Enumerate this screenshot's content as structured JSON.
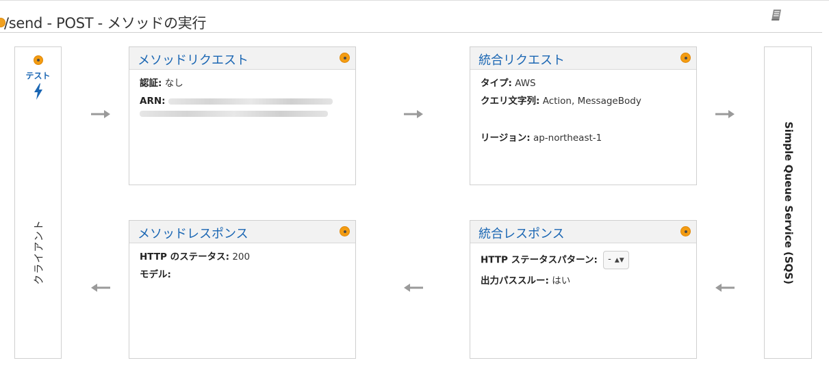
{
  "header": {
    "title": "/send - POST - メソッドの実行"
  },
  "client": {
    "test_label": "テスト",
    "label": "クライアント"
  },
  "backend": {
    "label": "Simple Queue Service (SQS)"
  },
  "method_request": {
    "title": "メソッドリクエスト",
    "auth_label": "認証:",
    "auth_value": "なし",
    "arn_label": "ARN:"
  },
  "integration_request": {
    "title": "統合リクエスト",
    "type_label": "タイプ:",
    "type_value": "AWS",
    "query_label": "クエリ文字列:",
    "query_value": "Action, MessageBody",
    "region_label": "リージョン:",
    "region_value": "ap-northeast-1"
  },
  "method_response": {
    "title": "メソッドレスポンス",
    "status_label": "HTTP のステータス:",
    "status_value": "200",
    "model_label": "モデル:"
  },
  "integration_response": {
    "title": "統合レスポンス",
    "pattern_label": "HTTP ステータスパターン:",
    "pattern_value": "-",
    "passthrough_label": "出力パススルー:",
    "passthrough_value": "はい"
  },
  "colors": {
    "accent": "#1a66b3",
    "status_dot": "#f39c12"
  },
  "icons": [
    "docs-icon",
    "lightning-icon",
    "status-dot-icon",
    "arrow-right-icon",
    "arrow-left-icon"
  ]
}
